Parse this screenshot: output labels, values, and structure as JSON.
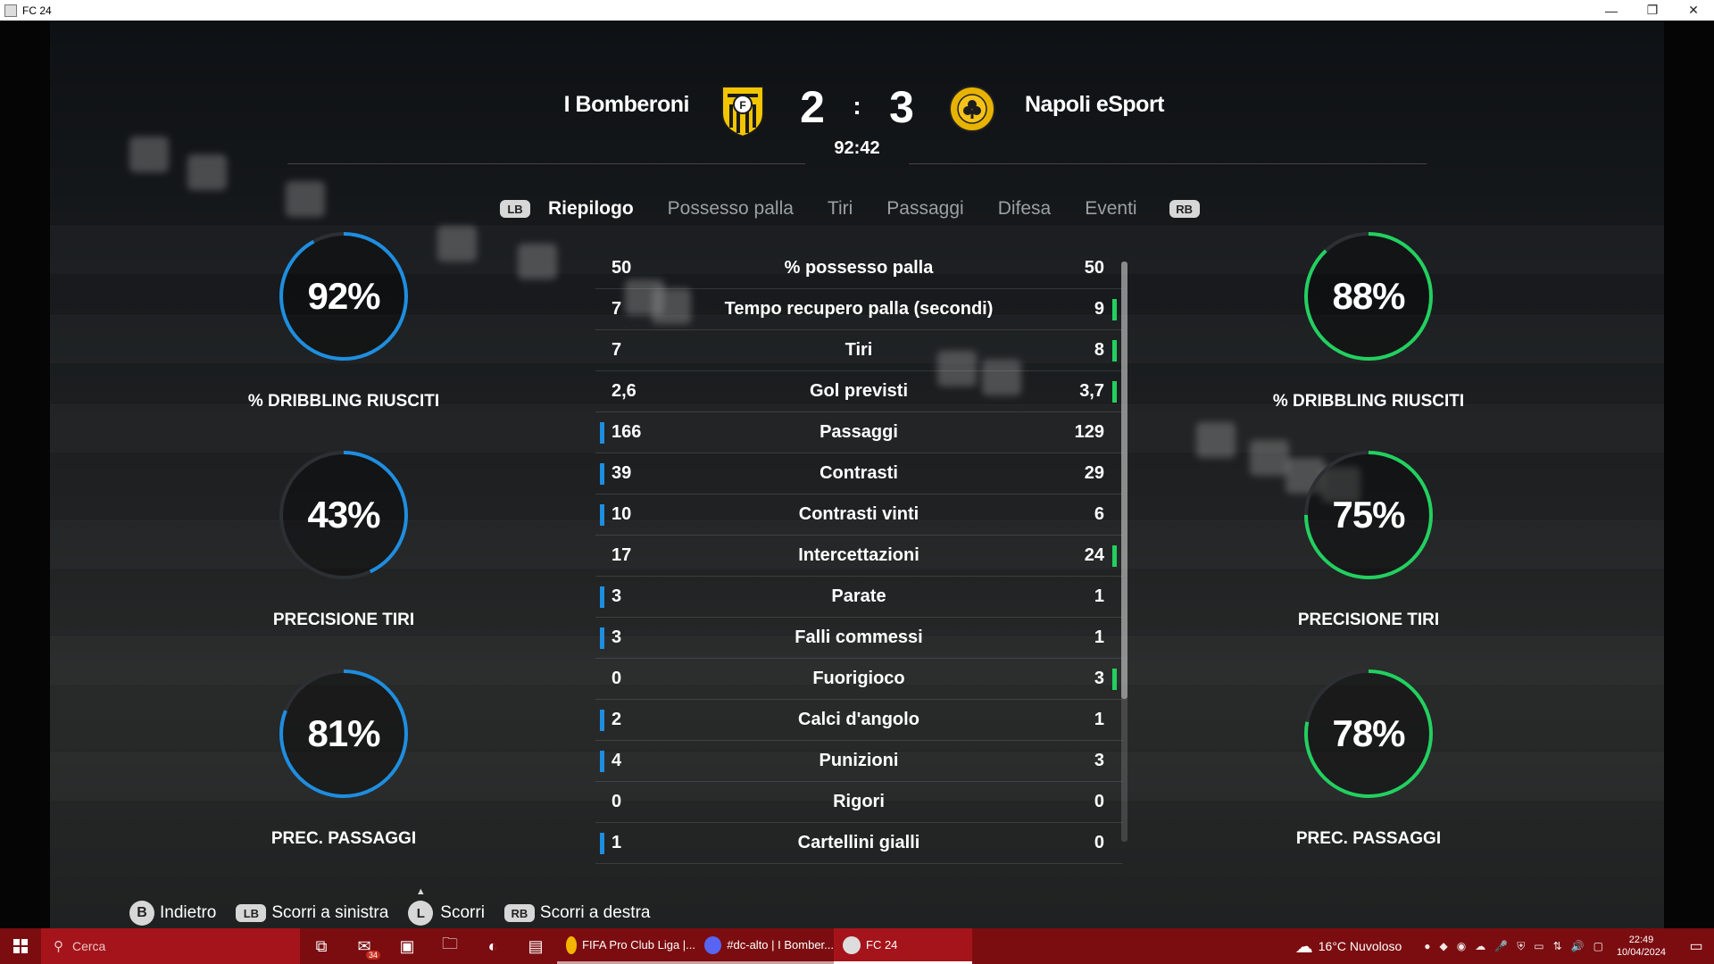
{
  "window": {
    "title": "FC 24",
    "minimize": "—",
    "restore": "❐",
    "close": "✕"
  },
  "match": {
    "home_team": "I Bomberoni",
    "away_team": "Napoli eSport",
    "home_score": "2",
    "separator": ":",
    "away_score": "3",
    "time": "92:42",
    "home_color": "#1e8ee0",
    "away_color": "#22d060"
  },
  "tabs": {
    "lb": "LB",
    "rb": "RB",
    "items": [
      "Riepilogo",
      "Possesso palla",
      "Tiri",
      "Passaggi",
      "Difesa",
      "Eventi"
    ],
    "active": "Riepilogo"
  },
  "rings": {
    "home": [
      {
        "value": 92,
        "pct": "92%",
        "label": "% DRIBBLING RIUSCITI"
      },
      {
        "value": 43,
        "pct": "43%",
        "label": "PRECISIONE TIRI"
      },
      {
        "value": 81,
        "pct": "81%",
        "label": "PREC. PASSAGGI"
      }
    ],
    "away": [
      {
        "value": 88,
        "pct": "88%",
        "label": "% DRIBBLING RIUSCITI"
      },
      {
        "value": 75,
        "pct": "75%",
        "label": "PRECISIONE TIRI"
      },
      {
        "value": 78,
        "pct": "78%",
        "label": "PREC. PASSAGGI"
      }
    ]
  },
  "stats": [
    {
      "name": "% possesso palla",
      "home": "50",
      "away": "50",
      "lead": "none"
    },
    {
      "name": "Tempo recupero palla (secondi)",
      "home": "7",
      "away": "9",
      "lead": "away"
    },
    {
      "name": "Tiri",
      "home": "7",
      "away": "8",
      "lead": "away"
    },
    {
      "name": "Gol previsti",
      "home": "2,6",
      "away": "3,7",
      "lead": "away"
    },
    {
      "name": "Passaggi",
      "home": "166",
      "away": "129",
      "lead": "home"
    },
    {
      "name": "Contrasti",
      "home": "39",
      "away": "29",
      "lead": "home"
    },
    {
      "name": "Contrasti vinti",
      "home": "10",
      "away": "6",
      "lead": "home"
    },
    {
      "name": "Intercettazioni",
      "home": "17",
      "away": "24",
      "lead": "away"
    },
    {
      "name": "Parate",
      "home": "3",
      "away": "1",
      "lead": "home"
    },
    {
      "name": "Falli commessi",
      "home": "3",
      "away": "1",
      "lead": "home"
    },
    {
      "name": "Fuorigioco",
      "home": "0",
      "away": "3",
      "lead": "away"
    },
    {
      "name": "Calci d'angolo",
      "home": "2",
      "away": "1",
      "lead": "home"
    },
    {
      "name": "Punizioni",
      "home": "4",
      "away": "3",
      "lead": "home"
    },
    {
      "name": "Rigori",
      "home": "0",
      "away": "0",
      "lead": "none"
    },
    {
      "name": "Cartellini gialli",
      "home": "1",
      "away": "0",
      "lead": "home"
    }
  ],
  "footer": {
    "back_key": "B",
    "back_label": "Indietro",
    "left_key": "LB",
    "left_label": "Scorri a sinistra",
    "scroll_key": "L",
    "scroll_label": "Scorri",
    "right_key": "RB",
    "right_label": "Scorri a destra"
  },
  "taskbar": {
    "search_placeholder": "Cerca",
    "mail_badge": "34",
    "apps": [
      {
        "label": "FIFA Pro Club Liga |...",
        "color": "#f4b400"
      },
      {
        "label": "#dc-alto | I Bomber...",
        "color": "#5865f2"
      },
      {
        "label": "FC 24",
        "color": "#dddddd"
      }
    ],
    "weather": "16°C  Nuvoloso",
    "time": "22:49",
    "date": "10/04/2024"
  }
}
